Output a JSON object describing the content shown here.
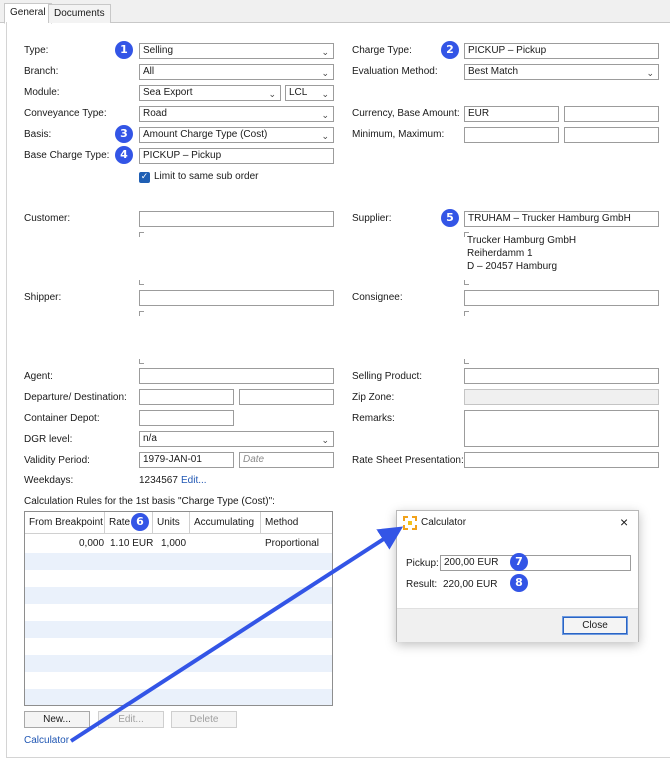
{
  "tabs": [
    {
      "label": "General"
    },
    {
      "label": "Documents"
    }
  ],
  "badges": [
    "1",
    "2",
    "3",
    "4",
    "5",
    "6",
    "7",
    "8"
  ],
  "form": {
    "type": {
      "label": "Type:",
      "value": "Selling"
    },
    "branch": {
      "label": "Branch:",
      "value": "All"
    },
    "module": {
      "label": "Module:",
      "value": "Sea Export",
      "sub_value": "LCL"
    },
    "conveyance_type": {
      "label": "Conveyance Type:",
      "value": "Road"
    },
    "basis": {
      "label": "Basis:",
      "value": "Amount Charge Type (Cost)"
    },
    "base_charge_type": {
      "label": "Base Charge Type:",
      "value": "PICKUP – Pickup"
    },
    "limit_same_sub_order": {
      "label": "Limit to same sub order",
      "checked": true
    },
    "charge_type": {
      "label": "Charge Type:",
      "value": "PICKUP – Pickup"
    },
    "evaluation_method": {
      "label": "Evaluation Method:",
      "value": "Best Match"
    },
    "currency_base_amount": {
      "label": "Currency, Base Amount:",
      "value": "EUR",
      "amount": ""
    },
    "minimum_maximum": {
      "label": "Minimum, Maximum:",
      "min": "",
      "max": ""
    },
    "customer": {
      "label": "Customer:",
      "value": ""
    },
    "supplier": {
      "label": "Supplier:",
      "value": "TRUHAM – Trucker Hamburg GmbH",
      "address": [
        "Trucker Hamburg GmbH",
        "Reiherdamm 1",
        "D – 20457 Hamburg"
      ]
    },
    "shipper": {
      "label": "Shipper:",
      "value": ""
    },
    "consignee": {
      "label": "Consignee:",
      "value": ""
    },
    "agent": {
      "label": "Agent:",
      "value": ""
    },
    "selling_product": {
      "label": "Selling Product:",
      "value": ""
    },
    "departure_destination": {
      "label": "Departure/ Destination:",
      "departure": "",
      "destination": ""
    },
    "zip_zone": {
      "label": "Zip Zone:",
      "value": ""
    },
    "container_depot": {
      "label": "Container Depot:",
      "value": ""
    },
    "remarks": {
      "label": "Remarks:",
      "value": ""
    },
    "dgr_level": {
      "label": "DGR level:",
      "value": "n/a"
    },
    "validity_period": {
      "label": "Validity Period:",
      "from": "1979-JAN-01",
      "to_placeholder": "Date"
    },
    "rate_sheet_presentation": {
      "label": "Rate Sheet Presentation:",
      "value": ""
    },
    "weekdays": {
      "label": "Weekdays:",
      "value": "1234567",
      "edit_link": "Edit..."
    }
  },
  "calc_rules": {
    "title": "Calculation Rules for the 1st basis \"Charge Type (Cost)\":",
    "columns": [
      "From Breakpoint",
      "Rate",
      "Units",
      "Accumulating",
      "Method"
    ],
    "rows": [
      {
        "from_breakpoint": "0,000",
        "rate": "1.10 EUR",
        "units": "1,000",
        "accumulating": "",
        "method": "Proportional"
      }
    ],
    "buttons": {
      "new": "New...",
      "edit": "Edit...",
      "delete": "Delete"
    },
    "calculator_link": "Calculator"
  },
  "calculator_dialog": {
    "title": "Calculator",
    "pickup_label": "Pickup:",
    "pickup_value": "200,00 EUR",
    "result_label": "Result:",
    "result_value": "220,00 EUR",
    "close_label": "Close"
  },
  "colors": {
    "badge": "#3355e6",
    "arrow": "#3355e6",
    "link": "#1f56b3",
    "stripe": "#eaf1fb"
  }
}
